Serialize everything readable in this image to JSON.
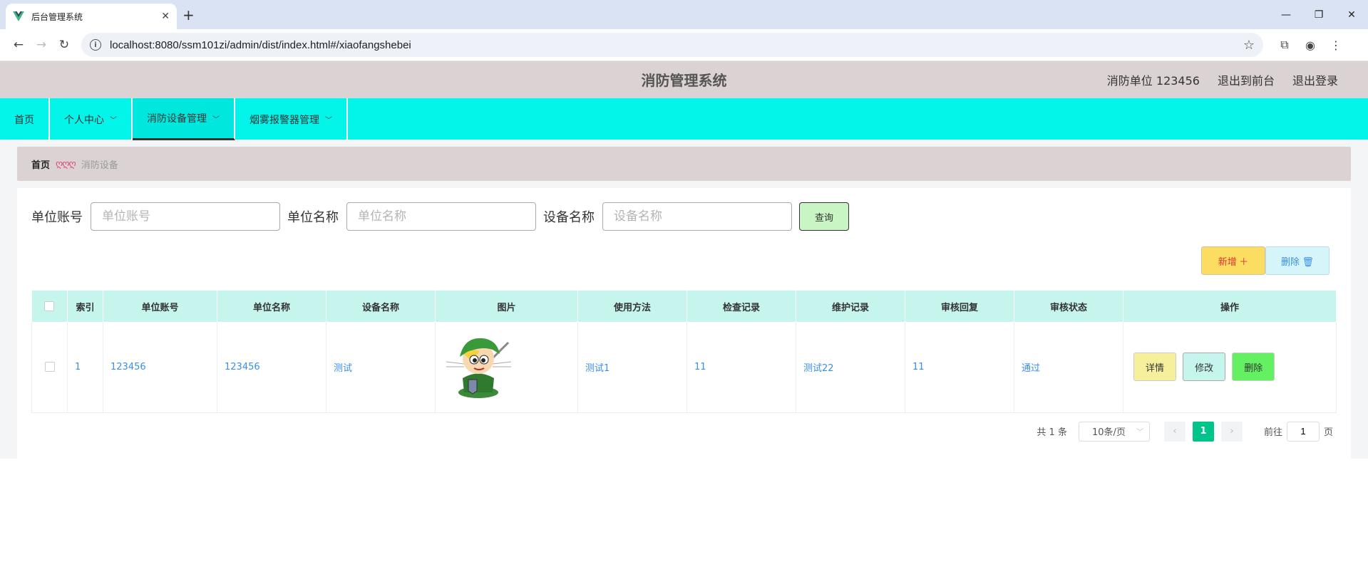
{
  "browser": {
    "tab_title": "后台管理系统",
    "url": "localhost:8080/ssm101zi/admin/dist/index.html#/xiaofangshebei"
  },
  "header": {
    "title": "消防管理系统",
    "user": "消防单位 123456",
    "to_front": "退出到前台",
    "logout": "退出登录"
  },
  "menu": {
    "items": [
      {
        "label": "首页"
      },
      {
        "label": "个人中心"
      },
      {
        "label": "消防设备管理"
      },
      {
        "label": "烟雾报警器管理"
      }
    ]
  },
  "breadcrumb": {
    "home": "首页",
    "separator": "ღღღ",
    "current": "消防设备"
  },
  "search": {
    "unit_account_label": "单位账号",
    "unit_account_placeholder": "单位账号",
    "unit_name_label": "单位名称",
    "unit_name_placeholder": "单位名称",
    "device_name_label": "设备名称",
    "device_name_placeholder": "设备名称",
    "query_label": "查询"
  },
  "actions": {
    "add_label": "新增 ＋",
    "delete_label": "删除 🗑"
  },
  "table": {
    "headers": [
      "索引",
      "单位账号",
      "单位名称",
      "设备名称",
      "图片",
      "使用方法",
      "检查记录",
      "维护记录",
      "审核回复",
      "审核状态",
      "操作"
    ],
    "rows": [
      {
        "index": "1",
        "unit_account": "123456",
        "unit_name": "123456",
        "device_name": "测试",
        "usage": "测试1",
        "inspection": "11",
        "maintenance": "测试22",
        "review_reply": "11",
        "review_status": "通过",
        "detail_label": "详情",
        "edit_label": "修改",
        "delete_label": "删除"
      }
    ]
  },
  "pager": {
    "total": "共 1 条",
    "page_size": "10条/页",
    "current_page": "1",
    "goto_prefix": "前往",
    "goto_value": "1",
    "goto_suffix": "页"
  }
}
